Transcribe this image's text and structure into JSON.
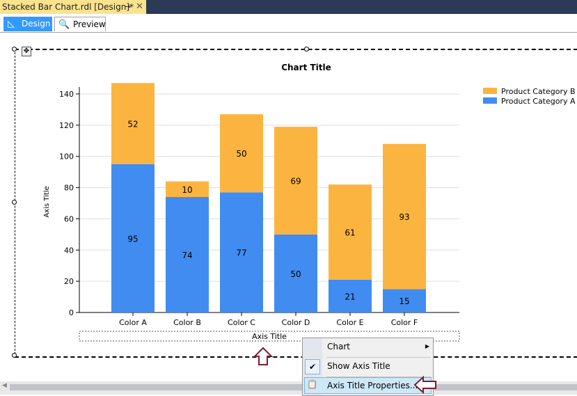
{
  "window": {
    "doc_tab_title": "Stacked Bar Chart.rdl [Design]*",
    "pin_icon": "pin-icon",
    "close_icon": "close-icon"
  },
  "view_tabs": [
    {
      "label": "Design",
      "active": true
    },
    {
      "label": "Preview",
      "active": false
    }
  ],
  "chart_data": {
    "type": "bar",
    "stacked": true,
    "title": "Chart Title",
    "xlabel": "Axis Title",
    "ylabel": "Axis Title",
    "categories": [
      "Color A",
      "Color B",
      "Color C",
      "Color D",
      "Color E",
      "Color F"
    ],
    "series": [
      {
        "name": "Product Category A",
        "color": "#418cf0",
        "values": [
          95,
          74,
          77,
          50,
          21,
          15
        ]
      },
      {
        "name": "Product Category B",
        "color": "#fcb441",
        "values": [
          52,
          10,
          50,
          69,
          61,
          93
        ]
      }
    ],
    "ylim": [
      0,
      140
    ],
    "yticks": [
      "0",
      "20",
      "40",
      "60",
      "80",
      "100",
      "120",
      "140"
    ],
    "legend": [
      "Product Category B",
      "Product Category A"
    ],
    "legend_position": "top-right",
    "grid": true
  },
  "context_menu": {
    "items": [
      {
        "label": "Chart",
        "submenu": true
      },
      {
        "label": "Show Axis Title",
        "checked": true
      },
      {
        "label": "Axis Title Properties...",
        "highlighted": true
      }
    ]
  }
}
